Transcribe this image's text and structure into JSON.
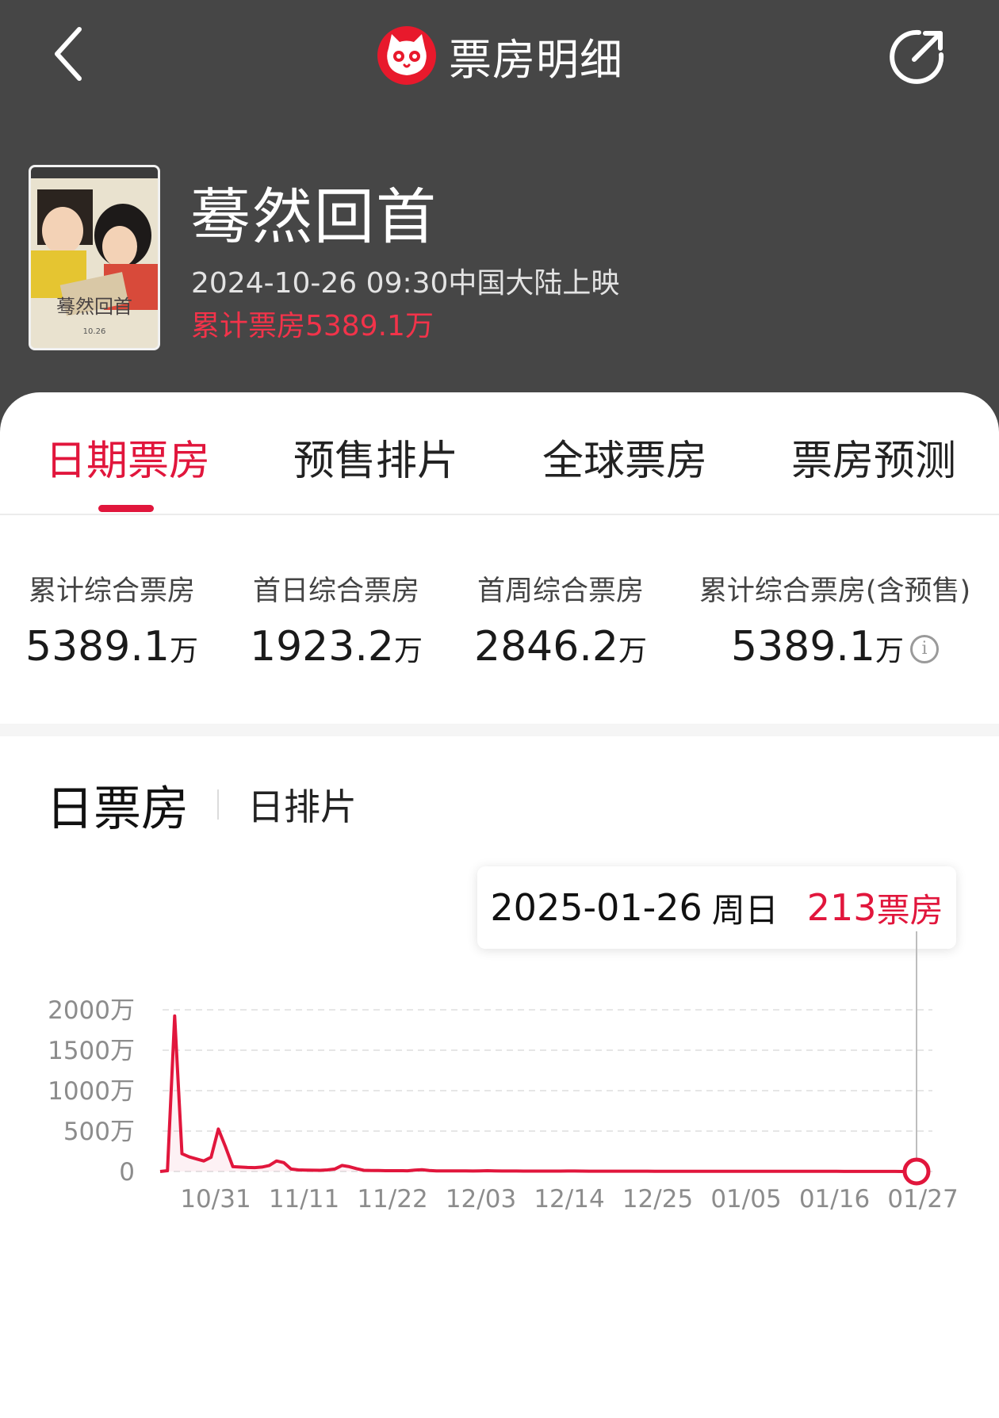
{
  "nav": {
    "title": "票房明细",
    "back_icon": "chevron-left-icon",
    "share_icon": "share-icon",
    "logo_icon": "cat-logo-icon"
  },
  "movie": {
    "title": "蓦然回首",
    "release": "2024-10-26 09:30中国大陆上映",
    "total": "累计票房5389.1万",
    "poster_title": "蓦然回首",
    "poster_date": "10.26"
  },
  "tabs": [
    {
      "label": "日期票房",
      "active": true
    },
    {
      "label": "预售排片",
      "active": false
    },
    {
      "label": "全球票房",
      "active": false
    },
    {
      "label": "票房预测",
      "active": false
    }
  ],
  "stats": [
    {
      "label": "累计综合票房",
      "value": "5389.1",
      "unit": "万"
    },
    {
      "label": "首日综合票房",
      "value": "1923.2",
      "unit": "万"
    },
    {
      "label": "首周综合票房",
      "value": "2846.2",
      "unit": "万"
    },
    {
      "label": "累计综合票房(含预售)",
      "value": "5389.1",
      "unit": "万",
      "info_icon": "info-icon"
    }
  ],
  "chart_tabs": {
    "daily": "日票房",
    "schedule": "日排片"
  },
  "tooltip": {
    "date": "2025-01-26",
    "weekday": "周日",
    "value": "213",
    "unit": "票房"
  },
  "colors": {
    "accent": "#e1163c",
    "header_bg": "#464646",
    "total_text": "#f2334a"
  },
  "chart_data": {
    "type": "line",
    "ylim": [
      0,
      2000
    ],
    "y_ticks": [
      "0",
      "500万",
      "1000万",
      "1500万",
      "2000万"
    ],
    "x_ticks": [
      "10/31",
      "11/11",
      "11/22",
      "12/03",
      "12/14",
      "12/25",
      "01/05",
      "01/16",
      "01/27"
    ],
    "start_date": "2024-10-25",
    "values": [
      0,
      10,
      1923.2,
      220,
      180,
      155,
      130,
      175,
      525,
      300,
      60,
      55,
      50,
      48,
      55,
      75,
      130,
      110,
      30,
      20,
      18,
      16,
      15,
      20,
      30,
      75,
      60,
      35,
      15,
      12,
      12,
      10,
      10,
      10,
      9,
      18,
      22,
      12,
      8,
      8,
      7,
      7,
      7,
      6,
      8,
      10,
      8,
      6,
      6,
      6,
      5,
      5,
      5,
      5,
      5,
      5,
      6,
      6,
      5,
      4,
      4,
      4,
      4,
      4,
      4,
      3.5,
      3.5,
      3.5,
      3,
      3,
      3,
      3,
      3,
      3,
      2.5,
      2.5,
      2.5,
      2.5,
      2.5,
      2,
      2,
      2,
      2,
      2,
      2,
      2,
      2,
      2,
      2,
      1.5,
      1.5,
      1.5,
      1.5,
      1.5,
      1,
      1,
      1,
      1,
      1,
      0.6,
      0.5,
      0.5,
      0.4,
      0.2,
      0.0213
    ],
    "highlight": {
      "date": "2025-01-26",
      "value": 0.0213
    }
  }
}
